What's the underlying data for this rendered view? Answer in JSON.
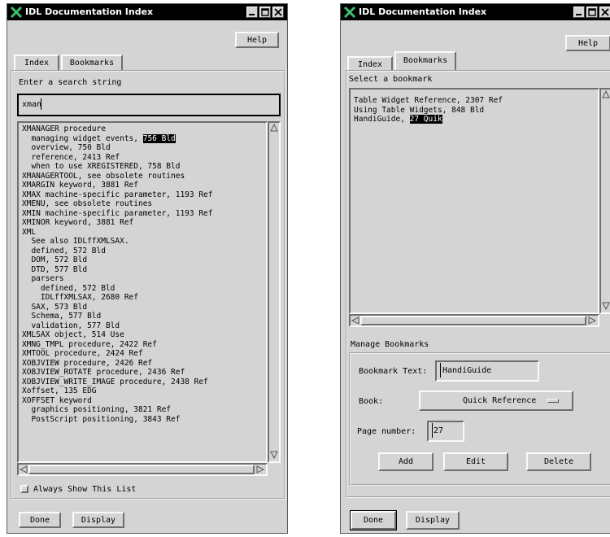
{
  "window_left": {
    "title": "IDL Documentation Index",
    "help_label": "Help",
    "tabs": [
      {
        "label": "Index",
        "active": true
      },
      {
        "label": "Bookmarks",
        "active": false
      }
    ],
    "search_prompt": "Enter a search string",
    "search_value": "xman",
    "index_entries": [
      {
        "text": "XMANAGER procedure"
      },
      {
        "text": "  managing widget events, ",
        "hl": "756 Bld"
      },
      {
        "text": "  overview, 750 Bld"
      },
      {
        "text": "  reference, 2413 Ref"
      },
      {
        "text": "  when to use XREGISTERED, 758 Bld"
      },
      {
        "text": "XMANAGERTOOL, see obsolete routines"
      },
      {
        "text": "XMARGIN keyword, 3881 Ref"
      },
      {
        "text": "XMAX machine-specific parameter, 1193 Ref"
      },
      {
        "text": "XMENU, see obsolete routines"
      },
      {
        "text": "XMIN machine-specific parameter, 1193 Ref"
      },
      {
        "text": "XMINOR keyword, 3881 Ref"
      },
      {
        "text": "XML"
      },
      {
        "text": "  See also IDLffXMLSAX."
      },
      {
        "text": "  defined, 572 Bld"
      },
      {
        "text": "  DOM, 572 Bld"
      },
      {
        "text": "  DTD, 577 Bld"
      },
      {
        "text": "  parsers"
      },
      {
        "text": "    defined, 572 Bld"
      },
      {
        "text": "    IDLffXMLSAX, 2680 Ref"
      },
      {
        "text": "  SAX, 573 Bld"
      },
      {
        "text": "  Schema, 577 Bld"
      },
      {
        "text": "  validation, 577 Bld"
      },
      {
        "text": "XMLSAX object, 514 Use"
      },
      {
        "text": "XMNG_TMPL procedure, 2422 Ref"
      },
      {
        "text": "XMTOOL procedure, 2424 Ref"
      },
      {
        "text": "XOBJVIEW procedure, 2426 Ref"
      },
      {
        "text": "XOBJVIEW_ROTATE procedure, 2436 Ref"
      },
      {
        "text": "XOBJVIEW_WRITE_IMAGE procedure, 2438 Ref"
      },
      {
        "text": "Xoffset, 135 EDG"
      },
      {
        "text": "XOFFSET keyword"
      },
      {
        "text": "  graphics positioning, 3821 Ref"
      },
      {
        "text": "  PostScript positioning, 3843 Ref"
      }
    ],
    "always_show_label": "Always Show This List",
    "always_show_checked": false,
    "done_label": "Done",
    "display_label": "Display"
  },
  "window_right": {
    "title": "IDL Documentation Index",
    "help_label": "Help",
    "tabs": [
      {
        "label": "Index",
        "active": false
      },
      {
        "label": "Bookmarks",
        "active": true
      }
    ],
    "select_prompt": "Select a bookmark",
    "bookmarks": [
      {
        "text": "Table Widget Reference, 2307 Ref"
      },
      {
        "text": "Using Table Widgets, 848 Bld"
      },
      {
        "text": "HandiGuide, ",
        "hl": "27 Quik"
      }
    ],
    "manage_label": "Manage Bookmarks",
    "bookmark_text_label": "Bookmark Text:",
    "bookmark_text_value": "HandiGuide",
    "book_label": "Book:",
    "book_value": "Quick Reference",
    "page_number_label": "Page number:",
    "page_number_value": "27",
    "add_label": "Add",
    "edit_label": "Edit",
    "delete_label": "Delete",
    "done_label": "Done",
    "display_label": "Display"
  },
  "colors": {
    "window_bg": "#d4d4d4",
    "titlebar_bg": "#000000",
    "highlight_bg": "#000000",
    "logo_green": "#2e8b57"
  }
}
